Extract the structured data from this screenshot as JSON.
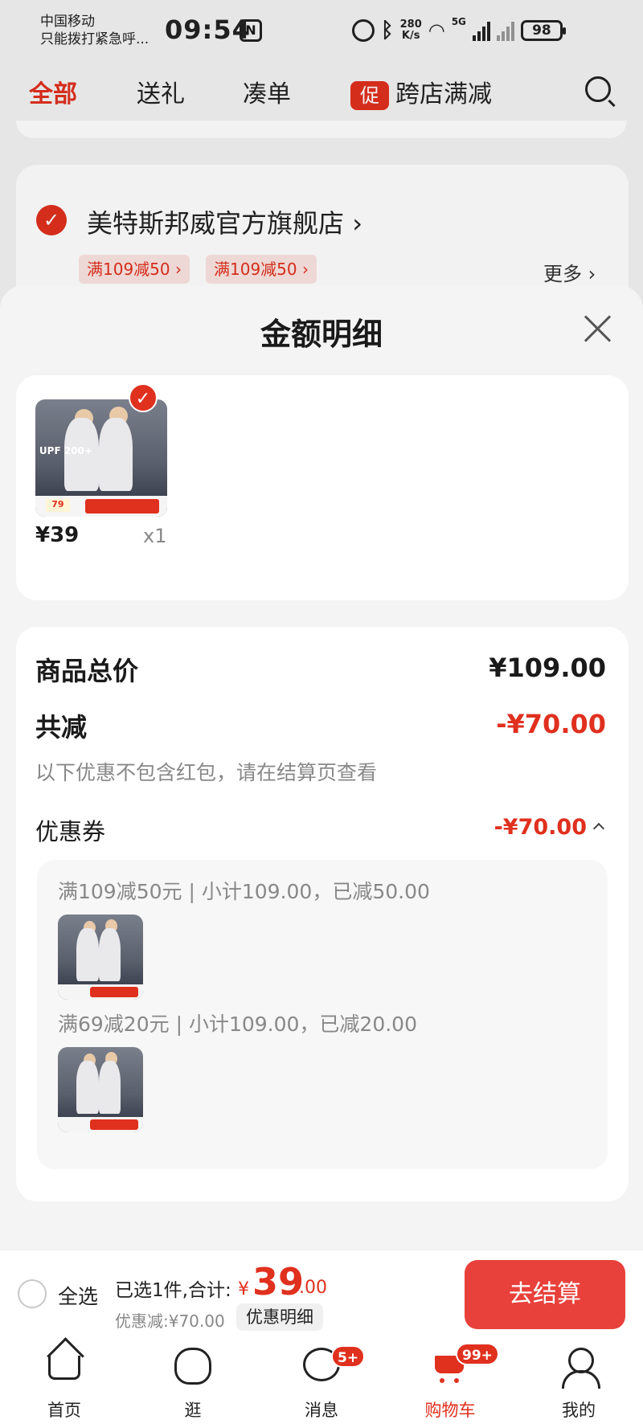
{
  "status_bar": {
    "carrier_line1": "中国移动",
    "carrier_line2": "只能拨打紧急呼...",
    "time": "09:54",
    "nfc": "N",
    "net_speed_value": "280",
    "net_speed_unit": "K/s",
    "signal_label": "5G",
    "battery": "98"
  },
  "top_tabs": {
    "all": "全部",
    "gift": "送礼",
    "bundle": "凑单",
    "promo_badge": "促",
    "cross_store": "跨店满减"
  },
  "store": {
    "name": "美特斯邦威官方旗舰店",
    "name_arrow": "›",
    "coupons": [
      "满109减50 ›",
      "满109减50 ›"
    ],
    "more": "更多 ›"
  },
  "sheet": {
    "title": "金额明细",
    "product": {
      "price": "¥39",
      "qty": "x1",
      "thumb_text": "UPF 200+",
      "thumb_price": "79"
    },
    "summary": {
      "total_label": "商品总价",
      "total_value": "¥109.00",
      "reduce_label": "共减",
      "reduce_value": "-¥70.00",
      "note": "以下优惠不包含红包，请在结算页查看",
      "coupon_label": "优惠券",
      "coupon_value": "-¥70.00",
      "coupon_lines": [
        "满109减50元 | 小计109.00，已减50.00",
        "满69减20元 | 小计109.00，已减20.00"
      ]
    }
  },
  "checkout": {
    "select_all": "全选",
    "selected_text": "已选1件,合计:",
    "currency": "¥",
    "total_int": "39",
    "total_dec": ".00",
    "discount": "优惠减:¥70.00",
    "detail_button": "优惠明细",
    "checkout_button": "去结算"
  },
  "bottom_nav": {
    "items": [
      {
        "label": "首页",
        "icon": "home-icon"
      },
      {
        "label": "逛",
        "icon": "stroll-icon"
      },
      {
        "label": "消息",
        "icon": "message-icon",
        "badge": "5+"
      },
      {
        "label": "购物车",
        "icon": "cart-icon",
        "badge": "99+"
      },
      {
        "label": "我的",
        "icon": "profile-icon"
      }
    ]
  },
  "colors": {
    "accent": "#e0301e",
    "checkout_button": "#e8403a"
  }
}
